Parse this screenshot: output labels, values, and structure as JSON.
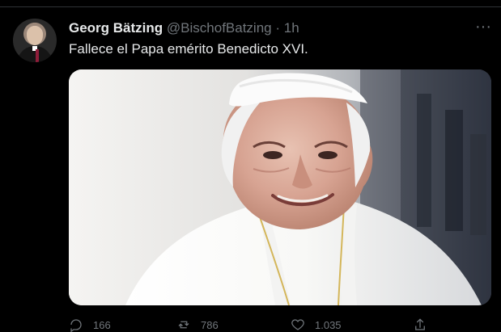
{
  "tweet": {
    "author_name": "Georg Bätzing",
    "author_handle": "@BischofBatzing",
    "separator": "·",
    "time": "1h",
    "text": "Fallece el Papa emérito Benedicto XVI."
  },
  "actions": {
    "reply_count": "166",
    "retweet_count": "786",
    "like_count": "1.035"
  },
  "icons": {
    "more": "more-options-icon",
    "reply": "reply-icon",
    "retweet": "retweet-icon",
    "like": "like-icon",
    "share": "share-icon"
  },
  "colors": {
    "background": "#000000",
    "primary_text": "#e7e9ea",
    "secondary_text": "#71767b",
    "divider": "#2f3336"
  }
}
